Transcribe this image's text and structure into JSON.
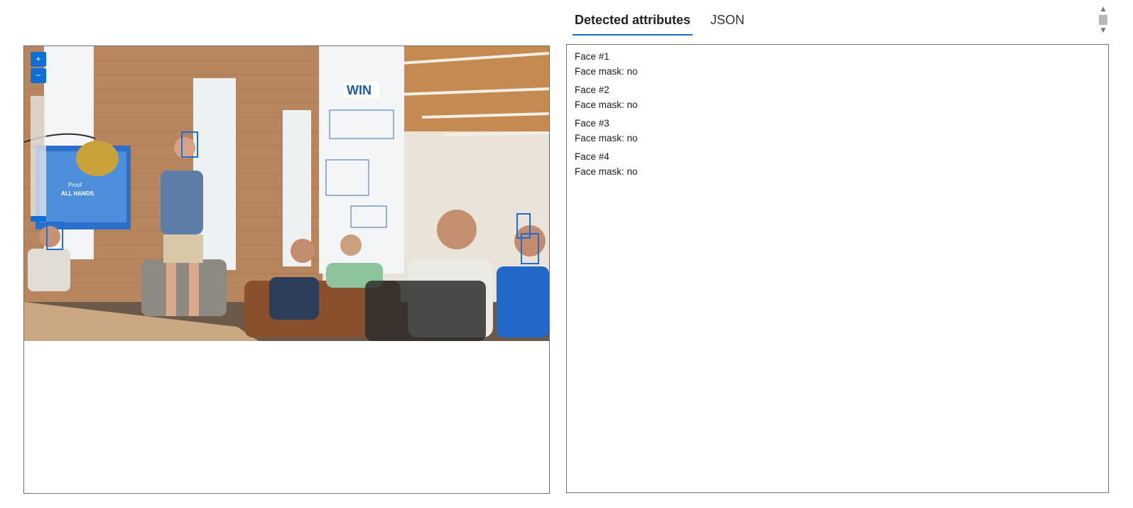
{
  "tabs": [
    {
      "label": "Detected attributes",
      "active": true
    },
    {
      "label": "JSON",
      "active": false
    }
  ],
  "viewer": {
    "zoom_in_label": "+",
    "zoom_out_label": "−",
    "photo_screen_text": {
      "line1": "Proof",
      "line2": "ALL HANDS"
    },
    "photo_wall_text": "WIN",
    "face_box_color": "#1e6fd0"
  },
  "results": {
    "faces": [
      {
        "title": "Face #1",
        "attribute": "Face mask: no"
      },
      {
        "title": "Face #2",
        "attribute": "Face mask: no"
      },
      {
        "title": "Face #3",
        "attribute": "Face mask: no"
      },
      {
        "title": "Face #4",
        "attribute": "Face mask: no"
      }
    ]
  },
  "scrollbar": {
    "up_icon": "chevron-up-icon",
    "down_icon": "chevron-down-icon"
  },
  "colors": {
    "accent": "#0f6fd4",
    "border": "#6f6f6f"
  }
}
